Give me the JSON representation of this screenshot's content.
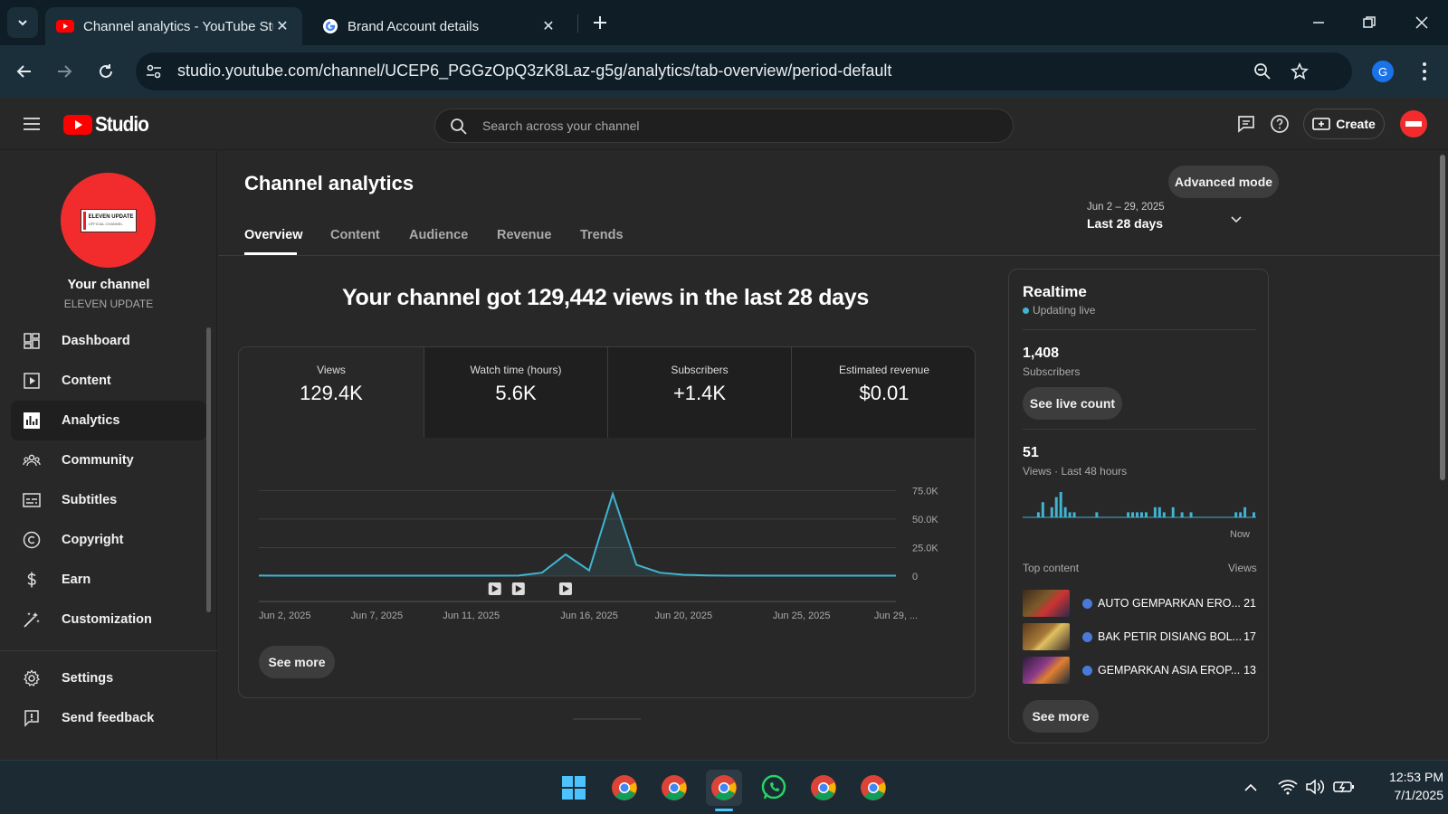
{
  "browser": {
    "tabs": [
      {
        "title": "Channel analytics - YouTube Studio",
        "active": true,
        "icon": "youtube-favicon"
      },
      {
        "title": "Brand Account details",
        "active": false,
        "icon": "google-favicon"
      }
    ],
    "url": "studio.youtube.com/channel/UCEP6_PGGzOpQ3zK8Laz-g5g/analytics/tab-overview/period-default",
    "profile_initial": "G"
  },
  "studio": {
    "logo_text": "Studio",
    "search_placeholder": "Search across your channel",
    "create_label": "Create"
  },
  "channel": {
    "label": "Your channel",
    "name": "ELEVEN UPDATE",
    "avatar_text": "ELEVEN UPDATE",
    "avatar_subtext": "OFFICIAL CHANNEL",
    "avatar_color": "#f22c2c"
  },
  "sidebar": {
    "items": [
      {
        "label": "Dashboard",
        "icon": "dashboard-icon"
      },
      {
        "label": "Content",
        "icon": "content-icon"
      },
      {
        "label": "Analytics",
        "icon": "analytics-icon",
        "selected": true
      },
      {
        "label": "Community",
        "icon": "community-icon"
      },
      {
        "label": "Subtitles",
        "icon": "subtitles-icon"
      },
      {
        "label": "Copyright",
        "icon": "copyright-icon"
      },
      {
        "label": "Earn",
        "icon": "earn-icon"
      },
      {
        "label": "Customization",
        "icon": "customization-icon"
      }
    ],
    "bottom": [
      {
        "label": "Settings",
        "icon": "settings-icon"
      },
      {
        "label": "Send feedback",
        "icon": "feedback-icon"
      }
    ]
  },
  "page": {
    "title": "Channel analytics",
    "advanced_mode": "Advanced mode",
    "tabs": [
      "Overview",
      "Content",
      "Audience",
      "Revenue",
      "Trends"
    ],
    "active_tab": "Overview",
    "date_range": "Jun 2 – 29, 2025",
    "period": "Last 28 days",
    "headline": "Your channel got 129,442 views in the last 28 days",
    "see_more": "See more"
  },
  "metrics": [
    {
      "label": "Views",
      "value": "129.4K"
    },
    {
      "label": "Watch time (hours)",
      "value": "5.6K"
    },
    {
      "label": "Subscribers",
      "value": "+1.4K"
    },
    {
      "label": "Estimated revenue",
      "value": "$0.01"
    }
  ],
  "chart_data": {
    "type": "area",
    "series": [
      {
        "values": [
          500,
          400,
          400,
          400,
          400,
          400,
          400,
          400,
          400,
          400,
          400,
          500,
          3000,
          19000,
          5000,
          72000,
          10000,
          3000,
          1200,
          600,
          400,
          400,
          400,
          400,
          400,
          400,
          400,
          400
        ]
      }
    ],
    "x_labels": [
      "Jun 2, 2025",
      "Jun 7, 2025",
      "Jun 11, 2025",
      "Jun 16, 2025",
      "Jun 20, 2025",
      "Jun 25, 2025",
      "Jun 29, ..."
    ],
    "x_label_days": [
      0,
      5,
      9,
      14,
      18,
      23,
      27
    ],
    "y_ticks": [
      "75.0K",
      "50.0K",
      "25.0K",
      "0"
    ],
    "y_tick_values": [
      75000,
      50000,
      25000,
      0
    ],
    "ylim": [
      0,
      80000
    ],
    "video_markers_days": [
      10,
      11,
      13
    ],
    "grid": true,
    "color": "#41b4d2"
  },
  "realtime": {
    "title": "Realtime",
    "status": "Updating live",
    "subscribers_value": "1,408",
    "subscribers_label": "Subscribers",
    "see_live_count": "See live count",
    "views_value": "51",
    "views_label": "Views · Last 48 hours",
    "now_label": "Now",
    "bar_color": "#41b4d2",
    "bars": [
      0,
      0,
      0,
      1,
      3,
      0,
      2,
      4,
      5,
      2,
      1,
      1,
      0,
      0,
      0,
      0,
      1,
      0,
      0,
      0,
      0,
      0,
      0,
      1,
      1,
      1,
      1,
      1,
      0,
      2,
      2,
      1,
      0,
      2,
      0,
      1,
      0,
      1,
      0,
      0,
      0,
      0,
      0,
      0,
      0,
      0,
      0,
      1,
      1,
      2,
      0,
      1
    ],
    "top_content_label": "Top content",
    "views_col_label": "Views",
    "top_content": [
      {
        "title": "AUTO GEMPARKAN ERO...",
        "views": "21"
      },
      {
        "title": "BAK PETIR DISIANG BOL...",
        "views": "17"
      },
      {
        "title": "GEMPARKAN ASIA EROP...",
        "views": "13"
      }
    ],
    "see_more": "See more"
  },
  "taskbar": {
    "time": "12:53 PM",
    "date": "7/1/2025"
  }
}
